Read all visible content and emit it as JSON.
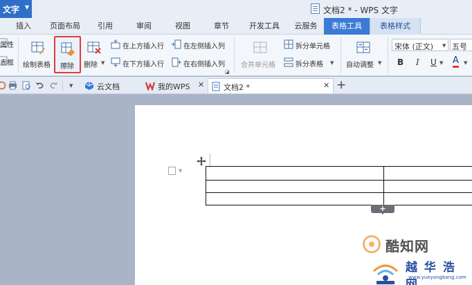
{
  "app": {
    "menu_label": "文字",
    "title": "文档2 * - WPS 文字"
  },
  "tabs": [
    {
      "label": "插入"
    },
    {
      "label": "页面布局"
    },
    {
      "label": "引用"
    },
    {
      "label": "审阅"
    },
    {
      "label": "视图"
    },
    {
      "label": "章节"
    },
    {
      "label": "开发工具"
    },
    {
      "label": "云服务"
    },
    {
      "label": "表格工具"
    },
    {
      "label": "表格样式"
    }
  ],
  "ribbon": {
    "left_partial_1": "属性",
    "left_partial_2": "表框",
    "draw_table": "绘制表格",
    "erase": "擦除",
    "delete": "删除",
    "insert_above": "在上方插入行",
    "insert_below": "在下方插入行",
    "insert_left": "在左侧插入列",
    "insert_right": "在右侧插入列",
    "merge_cells": "合并单元格",
    "split_cells": "拆分单元格",
    "split_table": "拆分表格",
    "auto_adjust": "自动调整",
    "font_name": "宋体 (正文)",
    "font_size": "五号",
    "bold": "B",
    "italic": "I",
    "underline": "U",
    "font_color": "A"
  },
  "quickbar": {
    "doc_tabs": [
      {
        "label": "云文档"
      },
      {
        "label": "我的WPS"
      },
      {
        "label": "文档2 *"
      }
    ],
    "new_tab": "+"
  },
  "watermark": {
    "text1": "酷知网",
    "text2": "越 华 浩 网",
    "url": "www.yueyangbang.com"
  },
  "colors": {
    "accent": "#3b7ad6",
    "highlight": "#e23a3a"
  }
}
